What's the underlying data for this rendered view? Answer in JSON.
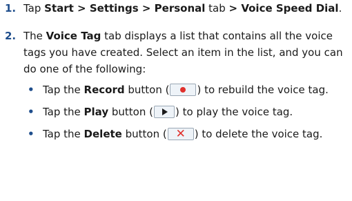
{
  "step1": {
    "number": "1.",
    "text_1": "Tap ",
    "bold_1": "Start > Settings > Personal",
    "text_2": " tab ",
    "bold_2": "> Voice Speed Dial",
    "text_3": "."
  },
  "step2": {
    "number": "2.",
    "text_1": "The ",
    "bold_1": "Voice Tag",
    "text_2": " tab displays a list that contains all the voice tags you have created. Select an item in the list, and you can do one of the following:"
  },
  "bullets": [
    {
      "dot": "•",
      "text_1": "Tap the ",
      "bold": "Record",
      "text_2": " button (",
      "icon": "record-icon",
      "text_3": ") to rebuild the voice tag."
    },
    {
      "dot": "•",
      "text_1": "Tap the ",
      "bold": "Play",
      "text_2": " button (",
      "icon": "play-icon",
      "text_3": ") to play the voice tag."
    },
    {
      "dot": "•",
      "text_1": "Tap the ",
      "bold": "Delete",
      "text_2": " button (",
      "icon": "delete-icon",
      "text_3": ") to delete the voice tag."
    }
  ],
  "colors": {
    "accent": "#1f4e8c",
    "record": "#e0302c",
    "delete": "#e0302c"
  }
}
